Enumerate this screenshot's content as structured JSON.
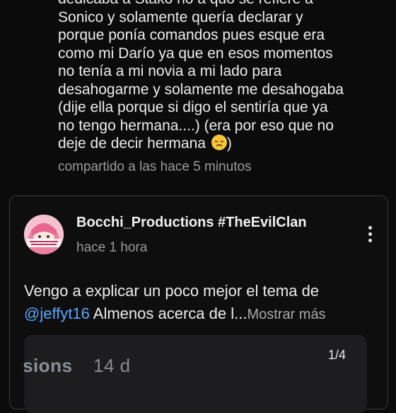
{
  "previous_comment": {
    "lines": [
      "dedicaba a Stako no a quo se refiere a",
      "Sonico y solamente quería declarar y",
      "porque ponía comandos pues esque era",
      "como mi Darío ya que en esos momentos",
      "no tenía a mi novia a mi lado para",
      "desahogarme y solamente me desahogaba",
      "(dije ella porque si digo el sentiría que ya",
      "no tengo hermana....) (era por eso que no",
      "deje de decir hermana"
    ],
    "last_line_tail": ")",
    "emoji_icon": "disappointed-face-emoji",
    "shared_meta": "compartido a las hace 5 minutos"
  },
  "post": {
    "author": "Bocchi_Productions #TheEvilClan",
    "time": "hace 1 hora",
    "avatar_icon": "anime-avatar",
    "menu_icon": "kebab-menu-icon",
    "text_line1": "Vengo a explicar un poco mejor el tema de",
    "mention": "@jeffyt16",
    "text_line2": " Almenos acerca de l...",
    "more_label": "Mostrar más",
    "media": {
      "text_left": "sions",
      "text_right": "14 d",
      "counter": "1/4"
    }
  }
}
